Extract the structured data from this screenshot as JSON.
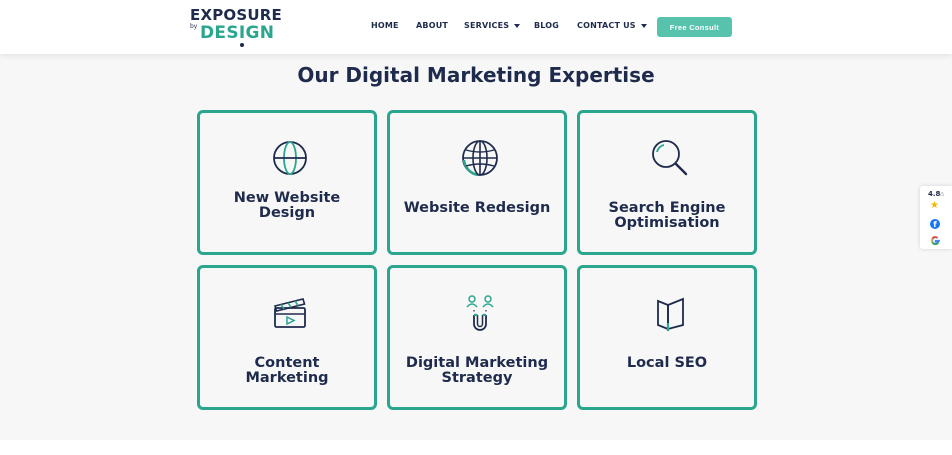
{
  "header": {
    "logo": {
      "top": "EXPOSURE",
      "by": "by",
      "bottom": "DESIGN"
    },
    "nav": [
      {
        "label": "HOME",
        "dropdown": false
      },
      {
        "label": "ABOUT",
        "dropdown": false
      },
      {
        "label": "SERVICES",
        "dropdown": true
      },
      {
        "label": "BLOG",
        "dropdown": false
      },
      {
        "label": "CONTACT US",
        "dropdown": true
      }
    ],
    "cta_label": "Free Consult"
  },
  "main": {
    "heading": "Our Digital Marketing Expertise",
    "cards": [
      {
        "title_line1": "New Website",
        "title_line2": "Design",
        "icon": "sphere-icon"
      },
      {
        "title_line1": "Website Redesign",
        "title_line2": "",
        "icon": "globe-icon"
      },
      {
        "title_line1": "Search Engine",
        "title_line2": "Optimisation",
        "icon": "magnifier-icon"
      },
      {
        "title_line1": "Content",
        "title_line2": "Marketing",
        "icon": "clapperboard-icon"
      },
      {
        "title_line1": "Digital Marketing",
        "title_line2": "Strategy",
        "icon": "magnet-people-icon"
      },
      {
        "title_line1": "Local SEO",
        "title_line2": "",
        "icon": "book-icon"
      }
    ]
  },
  "rating_widget": {
    "score": "4.8",
    "max": "/5",
    "icons": [
      "star-icon",
      "facebook-icon",
      "google-icon"
    ]
  },
  "colors": {
    "accent": "#2aa58e",
    "cta": "#58c3ad",
    "text": "#1f2b4d",
    "background": "#f7f7f7"
  }
}
